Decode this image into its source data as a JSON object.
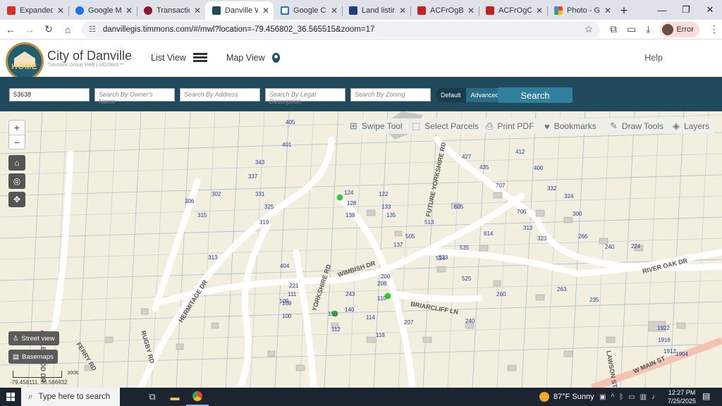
{
  "browser": {
    "tabs": [
      {
        "title": "Expanded Vie",
        "icon": "netflix-like-icon",
        "color": "#d93025",
        "active": false
      },
      {
        "title": "Google Messa",
        "icon": "messages-icon",
        "color": "#1a73e8",
        "active": false
      },
      {
        "title": "Transactions",
        "icon": "transactions-icon",
        "color": "#8b1a2b",
        "active": false
      },
      {
        "title": "Danville Web",
        "icon": "danville-icon",
        "color": "#1e4a5c",
        "active": true
      },
      {
        "title": "Google Calen",
        "icon": "calendar-icon",
        "color": "#1a73e8",
        "active": false
      },
      {
        "title": "Land listing -",
        "icon": "landlisting-icon",
        "color": "#1a3d7c",
        "active": false
      },
      {
        "title": "ACFrOgBKoul",
        "icon": "pdf-icon",
        "color": "#c5221f",
        "active": false
      },
      {
        "title": "ACFrOgCfyQt",
        "icon": "pdf-icon",
        "color": "#c5221f",
        "active": false
      },
      {
        "title": "Photo - Goog",
        "icon": "photos-icon",
        "color": "#fbbc04",
        "active": false
      }
    ],
    "url": "danvillegis.timmons.com/#/mwl?location=-79.456802_36.565515&zoom=17",
    "profile_label": "Error"
  },
  "app": {
    "city_name": "City of Danville",
    "subtitle": "Timmons Group Web Lo/GIStics™",
    "logo_text": "HOME",
    "nav": {
      "list_view": "List View",
      "map_view": "Map View",
      "help": "Help"
    }
  },
  "search": {
    "parcel_value": "53638",
    "owner_placeholder": "Search By Owner's Name",
    "address_placeholder": "Search By Address",
    "legal_placeholder": "Search By Legal Description",
    "zoning_placeholder": "Search By Zoning",
    "mode_default": "Default",
    "mode_advanced": "Advanced",
    "button": "Search"
  },
  "map": {
    "tools": [
      "Swipe Tool",
      "Select Parcels",
      "Print PDF",
      "Bookmarks",
      "Draw Tools",
      "Layers"
    ],
    "zoom_in": "+",
    "zoom_out": "−",
    "street_view": "Street view",
    "basemaps": "Basemaps",
    "coordinates": "-79.458111, 36.566932",
    "scale_label": "300ft",
    "street_labels": [
      "WIMBISH DR",
      "BRIARCLIFF LN",
      "RIVER OAK DR",
      "HERMITAGE DR",
      "FUTURE YORKSHIRE RD",
      "APPLEWOOD DR",
      "FERRY RD",
      "W MAIN ST",
      "LAWSON ST",
      "YORKSHIRE RD",
      "RUGBY RD"
    ],
    "lot_numbers": [
      "405",
      "401",
      "343",
      "337",
      "331",
      "325",
      "319",
      "315",
      "306",
      "302",
      "313",
      "138",
      "128",
      "124",
      "122",
      "133",
      "135",
      "137",
      "505",
      "513",
      "523",
      "535",
      "605",
      "706",
      "313",
      "323",
      "332",
      "324",
      "300",
      "266",
      "240",
      "224",
      "412",
      "400",
      "427",
      "435",
      "707",
      "614",
      "524",
      "525",
      "260",
      "263",
      "240",
      "208",
      "200",
      "110",
      "114",
      "118",
      "112",
      "150",
      "140",
      "404",
      "221",
      "207",
      "111",
      "109",
      "108",
      "100",
      "243",
      "235",
      "1922",
      "1916",
      "1912",
      "1904"
    ]
  },
  "taskbar": {
    "search_placeholder": "Type here to search",
    "weather": "87°F  Sunny",
    "time": "12:27 PM",
    "date": "7/25/2025"
  },
  "colors": {
    "header_band": "#1e4a5c",
    "search_button": "#2f7f9d",
    "map_bg": "#f3efdf",
    "parcel_line": "#a7bfcf",
    "lot_label": "#1d3f9e",
    "building": "#d3d0cb",
    "marker": "#37c83a"
  }
}
